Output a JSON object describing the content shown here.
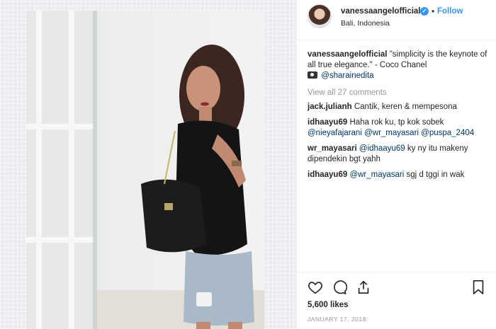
{
  "header": {
    "username": "vanessaangelofficial",
    "follow_label": "Follow",
    "dot": "•",
    "location": "Bali, Indonesia"
  },
  "caption": {
    "username": "vanessaangelofficial",
    "text": "\"simplicity is the keynote of all true elegance.\" - Coco Chanel",
    "mention": "@sharainedita"
  },
  "view_all": "View all 27 comments",
  "comments": [
    {
      "user": "jack.julianh",
      "text": "Cantik, keren & mempesona",
      "mentions": []
    },
    {
      "user": "idhaayu69",
      "text": "Haha rok ku, tp kok sobek",
      "mentions": [
        "@nieyafajarani",
        "@wr_mayasari",
        "@puspa_2404"
      ]
    },
    {
      "user": "wr_mayasari",
      "text": "ky ny itu makeny dipendekin bgt yahh",
      "mention_first": "@idhaayu69"
    },
    {
      "user": "idhaayu69",
      "text": "sgj d tggi in wak",
      "mention_first": "@wr_mayasari"
    }
  ],
  "likes": "5,600 likes",
  "date": "JANUARY 17, 2018",
  "icons": {
    "like": "heart-icon",
    "comment": "comment-icon",
    "share": "share-icon",
    "save": "bookmark-icon",
    "verified": "verified-badge-icon"
  },
  "colors": {
    "link_blue": "#3897f0",
    "mention": "#003569",
    "muted": "#999999"
  }
}
